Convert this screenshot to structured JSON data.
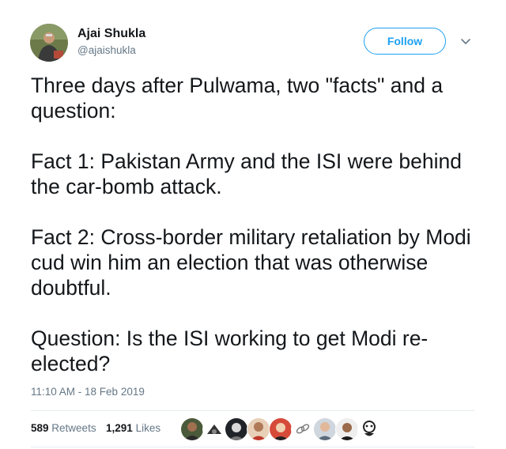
{
  "author": {
    "name": "Ajai Shukla",
    "handle": "@ajaishukla"
  },
  "follow_button": {
    "label": "Follow"
  },
  "tweet": {
    "paragraphs": [
      "Three days after Pulwama, two \"facts\" and a question:",
      "Fact 1:  Pakistan Army and the ISI were behind the car-bomb attack.",
      "Fact 2: Cross-border military retaliation by Modi cud win him an election that was otherwise doubtful.",
      "Question: Is the ISI working to get Modi re-elected?"
    ],
    "timestamp": "11:10 AM - 18 Feb 2019"
  },
  "stats": {
    "retweets_count": "589",
    "retweets_label": "Retweets",
    "likes_count": "1,291",
    "likes_label": "Likes"
  },
  "colors": {
    "accent": "#1da1f2",
    "secondary_text": "#657786",
    "primary_text": "#14171a",
    "divider": "#e6ecf0"
  },
  "icons": {
    "caret": "chevron-down-icon"
  }
}
